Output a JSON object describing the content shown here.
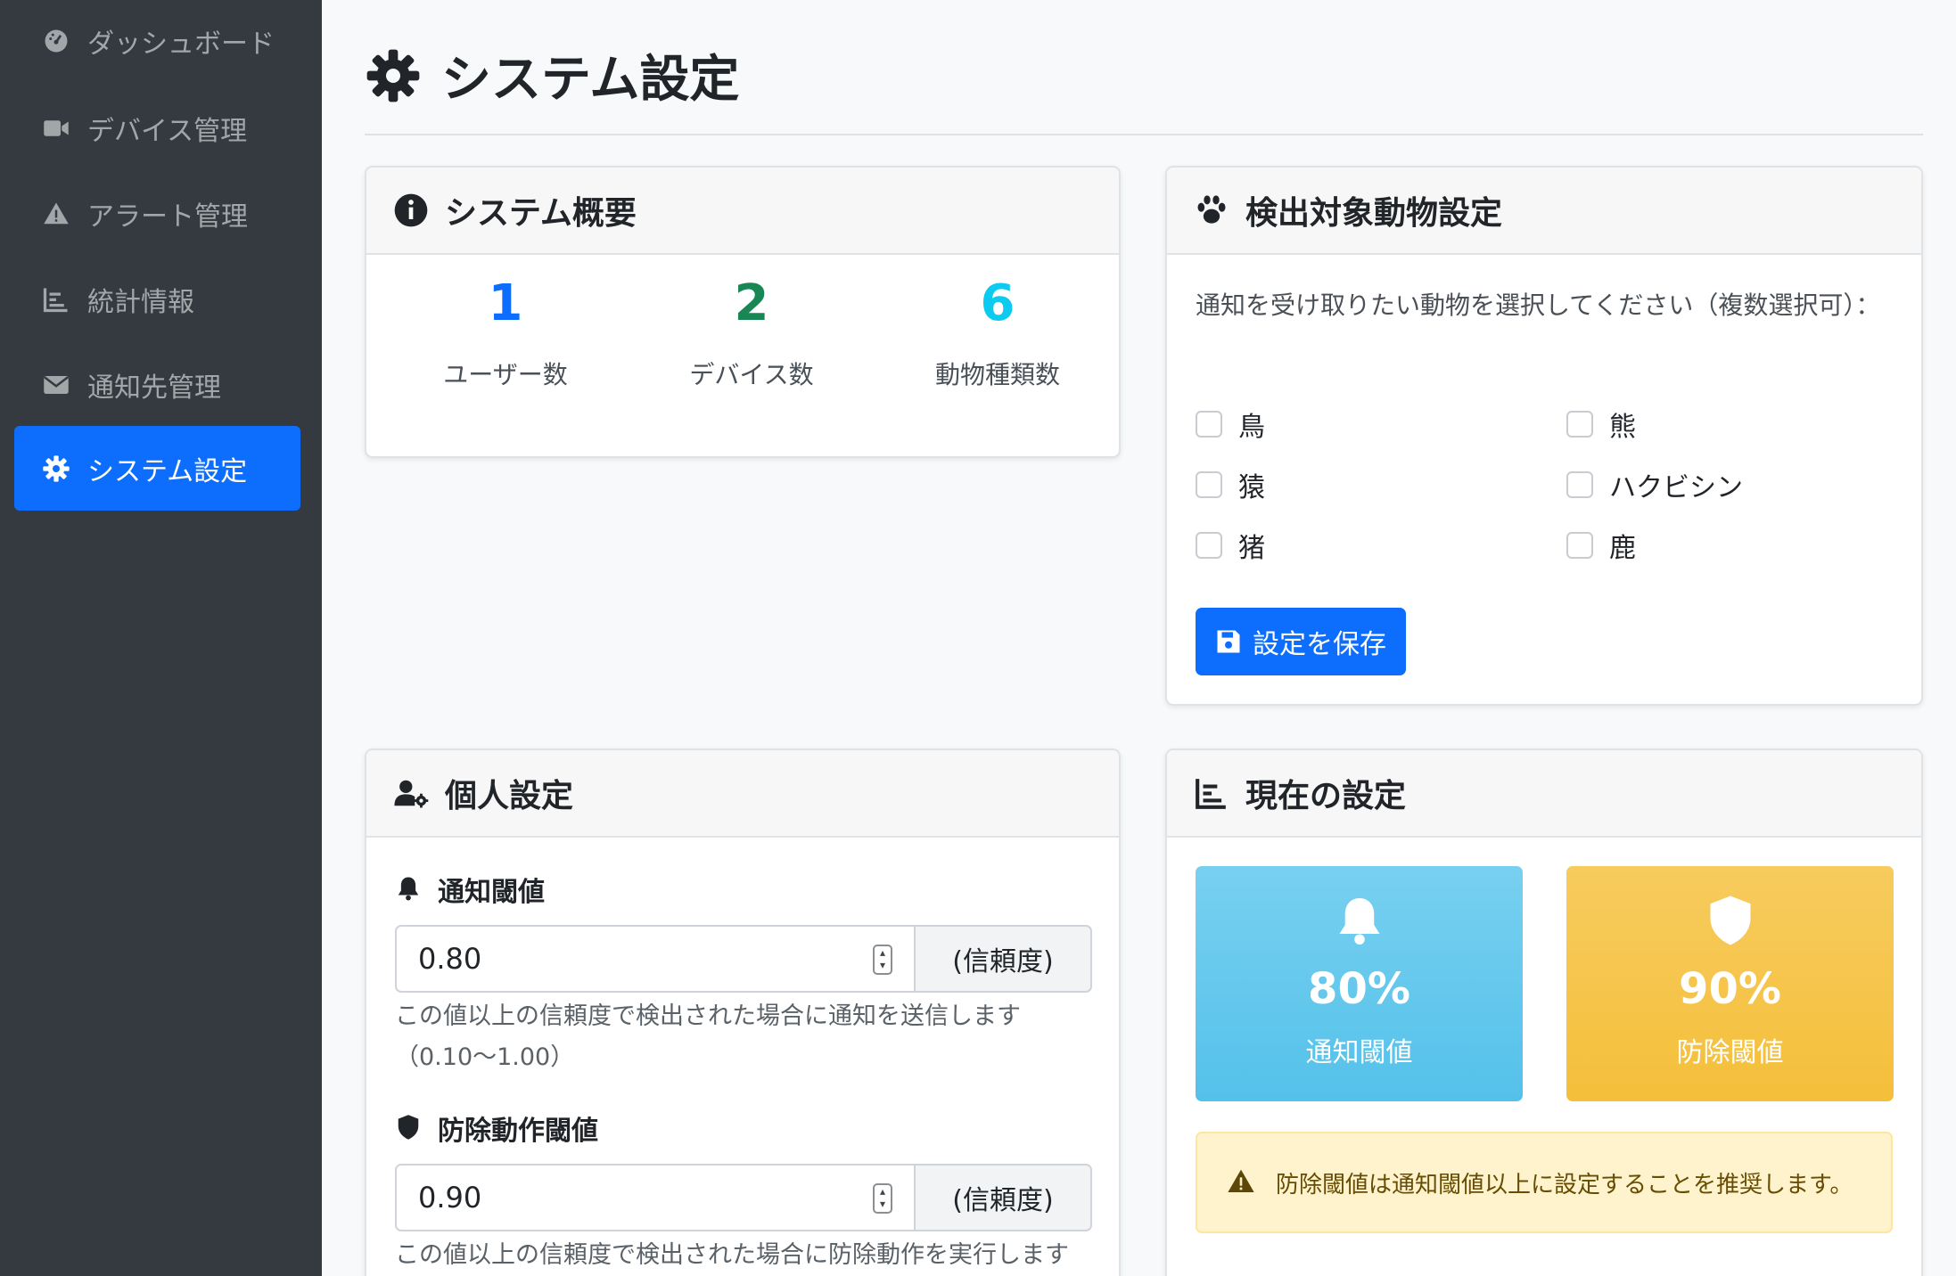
{
  "sidebar": {
    "items": [
      {
        "label": "ダッシュボード",
        "icon": "gauge-icon",
        "active": false
      },
      {
        "label": "デバイス管理",
        "icon": "video-camera-icon",
        "active": false
      },
      {
        "label": "アラート管理",
        "icon": "warning-icon",
        "active": false
      },
      {
        "label": "統計情報",
        "icon": "bar-chart-icon",
        "active": false
      },
      {
        "label": "通知先管理",
        "icon": "envelope-icon",
        "active": false
      },
      {
        "label": "システム設定",
        "icon": "gear-icon",
        "active": true
      }
    ]
  },
  "page": {
    "title": "システム設定"
  },
  "overview": {
    "title": "システム概要",
    "stats": [
      {
        "value": "1",
        "label": "ユーザー数",
        "color": "#0d6efd"
      },
      {
        "value": "2",
        "label": "デバイス数",
        "color": "#198754"
      },
      {
        "value": "6",
        "label": "動物種類数",
        "color": "#0dcaf0"
      }
    ]
  },
  "animals": {
    "title": "検出対象動物設定",
    "instruction": "通知を受け取りたい動物を選択してください（複数選択可）：",
    "options": [
      {
        "label": "鳥",
        "checked": false
      },
      {
        "label": "熊",
        "checked": false
      },
      {
        "label": "猿",
        "checked": false
      },
      {
        "label": "ハクビシン",
        "checked": false
      },
      {
        "label": "猪",
        "checked": false
      },
      {
        "label": "鹿",
        "checked": false
      }
    ],
    "save_label": "設定を保存"
  },
  "personal": {
    "title": "個人設定",
    "notify": {
      "label": "通知閾値",
      "value": "0.80",
      "unit": "(信頼度)",
      "help": "この値以上の信頼度で検出された場合に通知を送信します（0.10〜1.00）"
    },
    "defense": {
      "label": "防除動作閾値",
      "value": "0.90",
      "unit": "(信頼度)",
      "help": "この値以上の信頼度で検出された場合に防除動作を実行します"
    }
  },
  "current": {
    "title": "現在の設定",
    "tiles": [
      {
        "value": "80%",
        "label": "通知閾値",
        "color": "#5bc4ea",
        "icon": "bell-icon"
      },
      {
        "value": "90%",
        "label": "防除閾値",
        "color": "#f6c244",
        "icon": "shield-icon"
      }
    ],
    "alert": "防除閾値は通知閾値以上に設定することを推奨します。"
  }
}
